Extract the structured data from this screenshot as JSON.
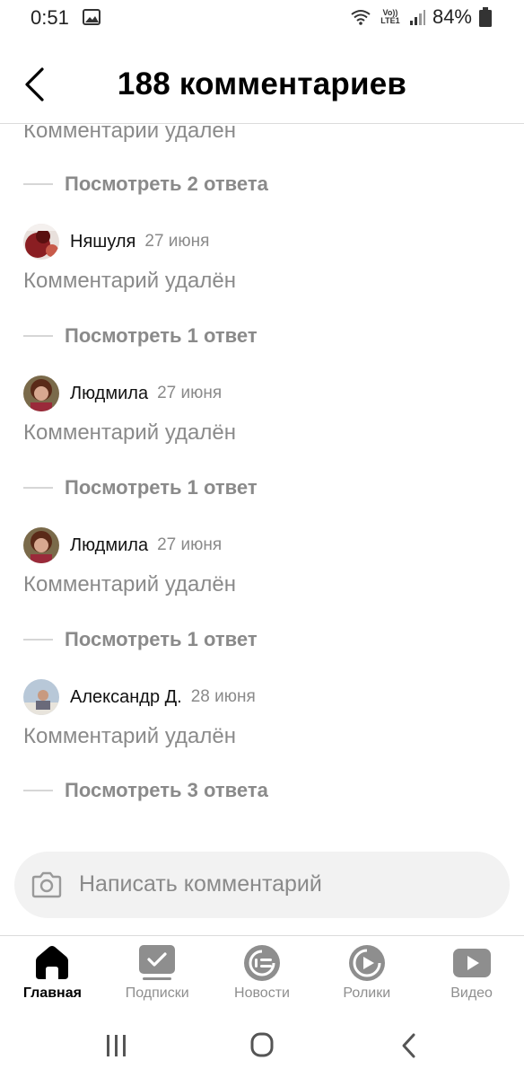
{
  "status_bar": {
    "time": "0:51",
    "network_label": "Vo)) LTE1",
    "battery_text": "84%"
  },
  "header": {
    "title": "188 комментариев"
  },
  "comments": {
    "partial_top_text": "Комментарий удален",
    "first_replies": "Посмотреть 2 ответа",
    "items": [
      {
        "author": "Няшуля",
        "date": "27 июня",
        "text": "Комментарий удалён",
        "replies": "Посмотреть 1 ответ"
      },
      {
        "author": "Людмила",
        "date": "27 июня",
        "text": "Комментарий удалён",
        "replies": "Посмотреть 1 ответ"
      },
      {
        "author": "Людмила",
        "date": "27 июня",
        "text": "Комментарий удалён",
        "replies": "Посмотреть 1 ответ"
      },
      {
        "author": "Александр Д.",
        "date": "28 июня",
        "text": "Комментарий удалён",
        "replies": "Посмотреть 3 ответа"
      }
    ]
  },
  "comment_input": {
    "placeholder": "Написать комментарий"
  },
  "bottom_nav": {
    "items": [
      {
        "label": "Главная",
        "icon": "home-icon",
        "active": true
      },
      {
        "label": "Подписки",
        "icon": "subscriptions-icon",
        "active": false
      },
      {
        "label": "Новости",
        "icon": "news-icon",
        "active": false
      },
      {
        "label": "Ролики",
        "icon": "clips-icon",
        "active": false
      },
      {
        "label": "Видео",
        "icon": "video-icon",
        "active": false
      }
    ]
  },
  "colors": {
    "muted_text": "#8a8a8a",
    "input_bg": "#f2f2f2",
    "active_icon": "#000000",
    "inactive_icon": "#8e8e8e"
  }
}
